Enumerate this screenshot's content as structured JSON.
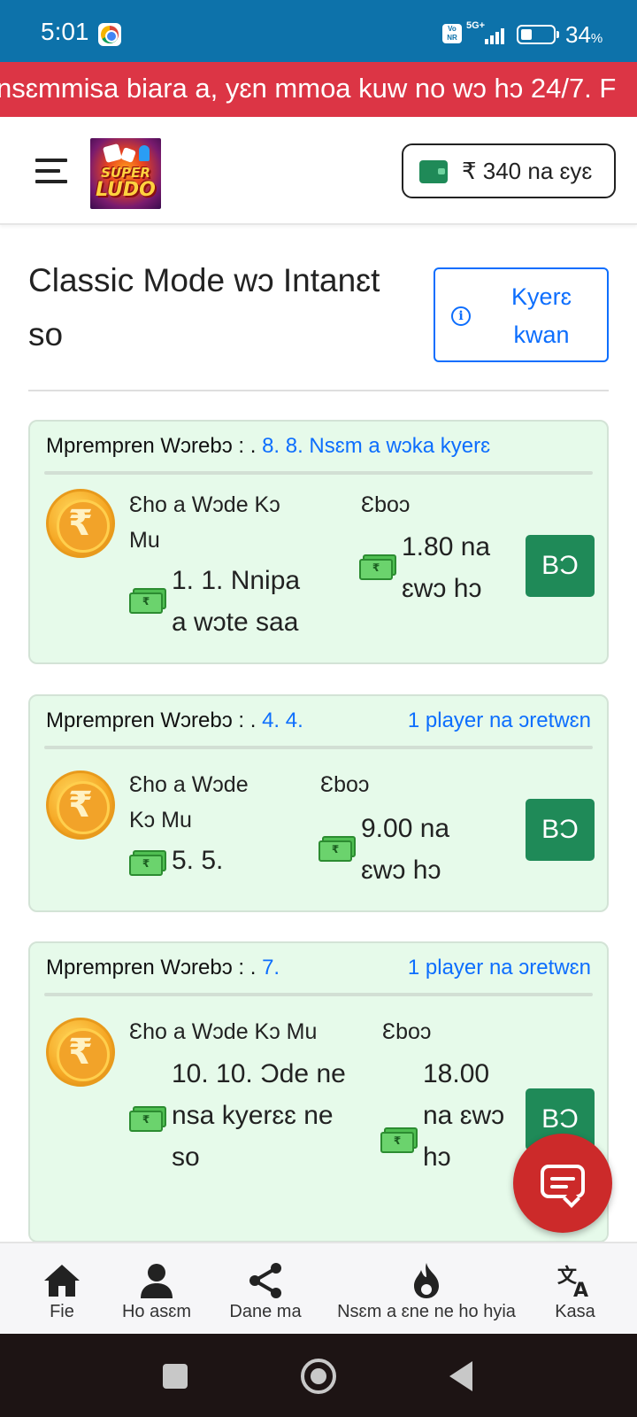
{
  "status_bar": {
    "time": "5:01",
    "network": "5G+",
    "volte": "Vo NR",
    "battery_pct": "34",
    "battery_unit": "%"
  },
  "marquee": {
    "text": "nsɛmmisa biara a, yɛn mmoa kuw no wɔ hɔ 24/7. F"
  },
  "header": {
    "logo_line1": "SUPER",
    "logo_line2": "LUDO",
    "wallet_text": "₹ 340 na ɛyɛ"
  },
  "page": {
    "title": "Classic Mode wɔ Intanɛt so",
    "guide_button": "Kyerɛ kwan",
    "info_icon": "i"
  },
  "cards": [
    {
      "head_label": "Mprempren Wɔrebɔ : .",
      "head_link": "8. 8. Nsɛm a wɔka kyerɛ",
      "head_right": "",
      "entry_label": "Ɛho a Wɔde Kɔ Mu",
      "entry_value": "1. 1. Nnipa a wɔte saa",
      "prize_label": "Ɛboɔ",
      "prize_value": "1.80 na ɛwɔ hɔ",
      "play_label": "BƆ"
    },
    {
      "head_label": "Mprempren Wɔrebɔ : .",
      "head_link": "4. 4.",
      "head_right": "1 player na ɔretwɛn",
      "entry_label": "Ɛho a Wɔde Kɔ Mu",
      "entry_value": "5. 5.",
      "prize_label": "Ɛboɔ",
      "prize_value": "9.00 na ɛwɔ hɔ",
      "play_label": "BƆ"
    },
    {
      "head_label": "Mprempren Wɔrebɔ : .",
      "head_link": "7.",
      "head_right": "1 player na ɔretwɛn",
      "entry_label": "Ɛho a Wɔde Kɔ Mu",
      "entry_value": "10. 10. Ɔde ne nsa kyerɛɛ ne so",
      "prize_label": "Ɛboɔ",
      "prize_value": "18.00 na ɛwɔ hɔ",
      "play_label": "BƆ"
    }
  ],
  "bottom_nav": [
    {
      "label": "Fie",
      "icon": "home-icon"
    },
    {
      "label": "Ho asɛm",
      "icon": "user-icon"
    },
    {
      "label": "Dane ma",
      "icon": "share-icon"
    },
    {
      "label": "Nsɛm a ɛne ne ho hyia",
      "icon": "fire-icon"
    },
    {
      "label": "Kasa",
      "icon": "translate-icon"
    }
  ],
  "colors": {
    "status_bar": "#0d72aa",
    "marquee": "#dc3545",
    "card_bg": "#e6faea",
    "play_button": "#1f8a58",
    "link_blue": "#0d6efd",
    "fab": "#cc2a2a"
  }
}
